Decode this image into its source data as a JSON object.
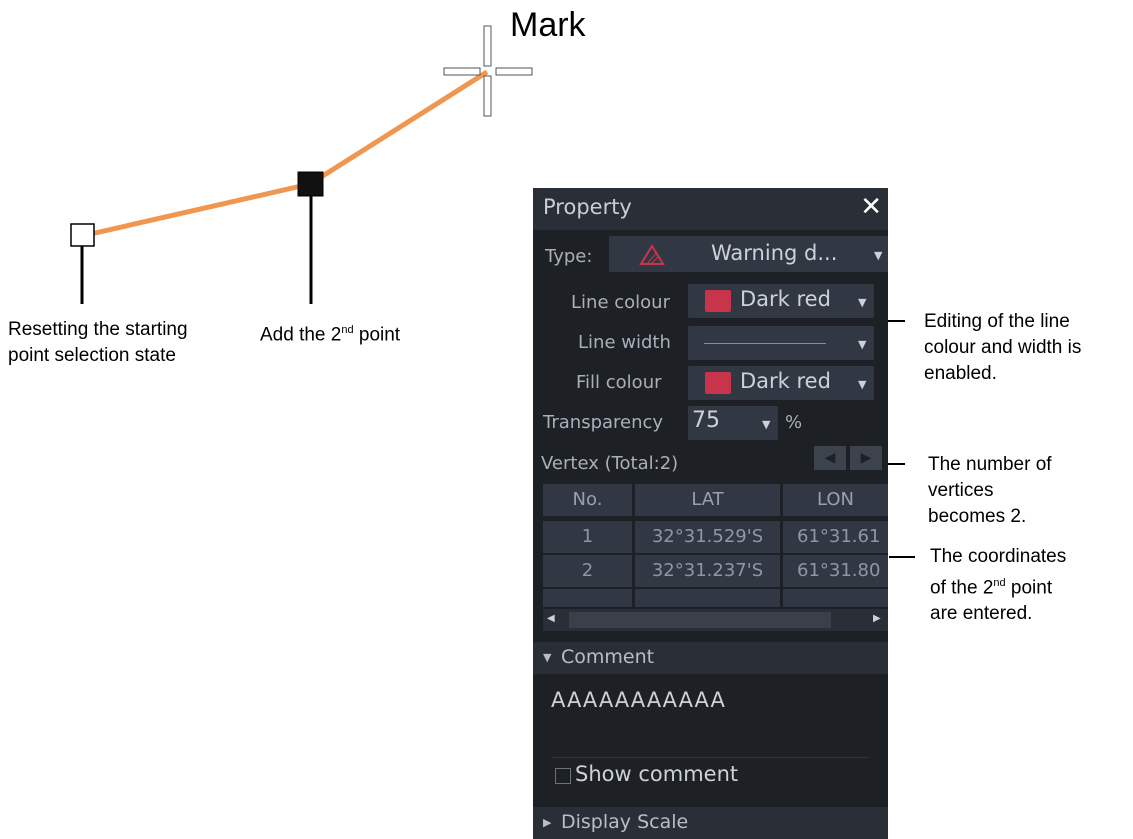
{
  "diagram": {
    "mark_label": "Mark",
    "annotation_start_point_line1": "Resetting the starting",
    "annotation_start_point_line2": "point selection state",
    "annotation_second_point_prefix": "Add the 2",
    "annotation_second_point_sup": "nd",
    "annotation_second_point_suffix": " point",
    "annotation_line_edit_line1": "Editing of the line",
    "annotation_line_edit_line2": "colour and width is",
    "annotation_line_edit_line3": "enabled.",
    "annotation_vertices_line1": "The number of",
    "annotation_vertices_line2": "vertices",
    "annotation_vertices_line3": "becomes 2.",
    "annotation_coords_line1": "The coordinates",
    "annotation_coords_line2_prefix": "of the 2",
    "annotation_coords_line2_sup": "nd",
    "annotation_coords_line2_suffix": " point",
    "annotation_coords_line3": "are entered.",
    "line_color": "#f0964f"
  },
  "panel": {
    "title": "Property",
    "close_glyph": "✕",
    "type_label": "Type:",
    "type_value": "Warning d...",
    "line_colour_label": "Line colour",
    "line_colour_value": "Dark red",
    "line_width_label": "Line width",
    "fill_colour_label": "Fill colour",
    "fill_colour_value": "Dark red",
    "transparency_label": "Transparency",
    "transparency_value": "75",
    "transparency_unit": "%",
    "vertex_label": "Vertex (Total:2)",
    "table_headers": [
      "No.",
      "LAT",
      "LON"
    ],
    "table_rows": [
      {
        "no": "1",
        "lat": "32°31.529'S",
        "lon": "61°31.61"
      },
      {
        "no": "2",
        "lat": "32°31.237'S",
        "lon": "61°31.80"
      }
    ],
    "comment_section": "Comment",
    "comment_text": "AAAAAAAAAAA",
    "show_comment_label": "Show comment",
    "display_scale_section": "Display Scale",
    "swatch_color": "#c8344c",
    "background_color": "#1d2025"
  }
}
